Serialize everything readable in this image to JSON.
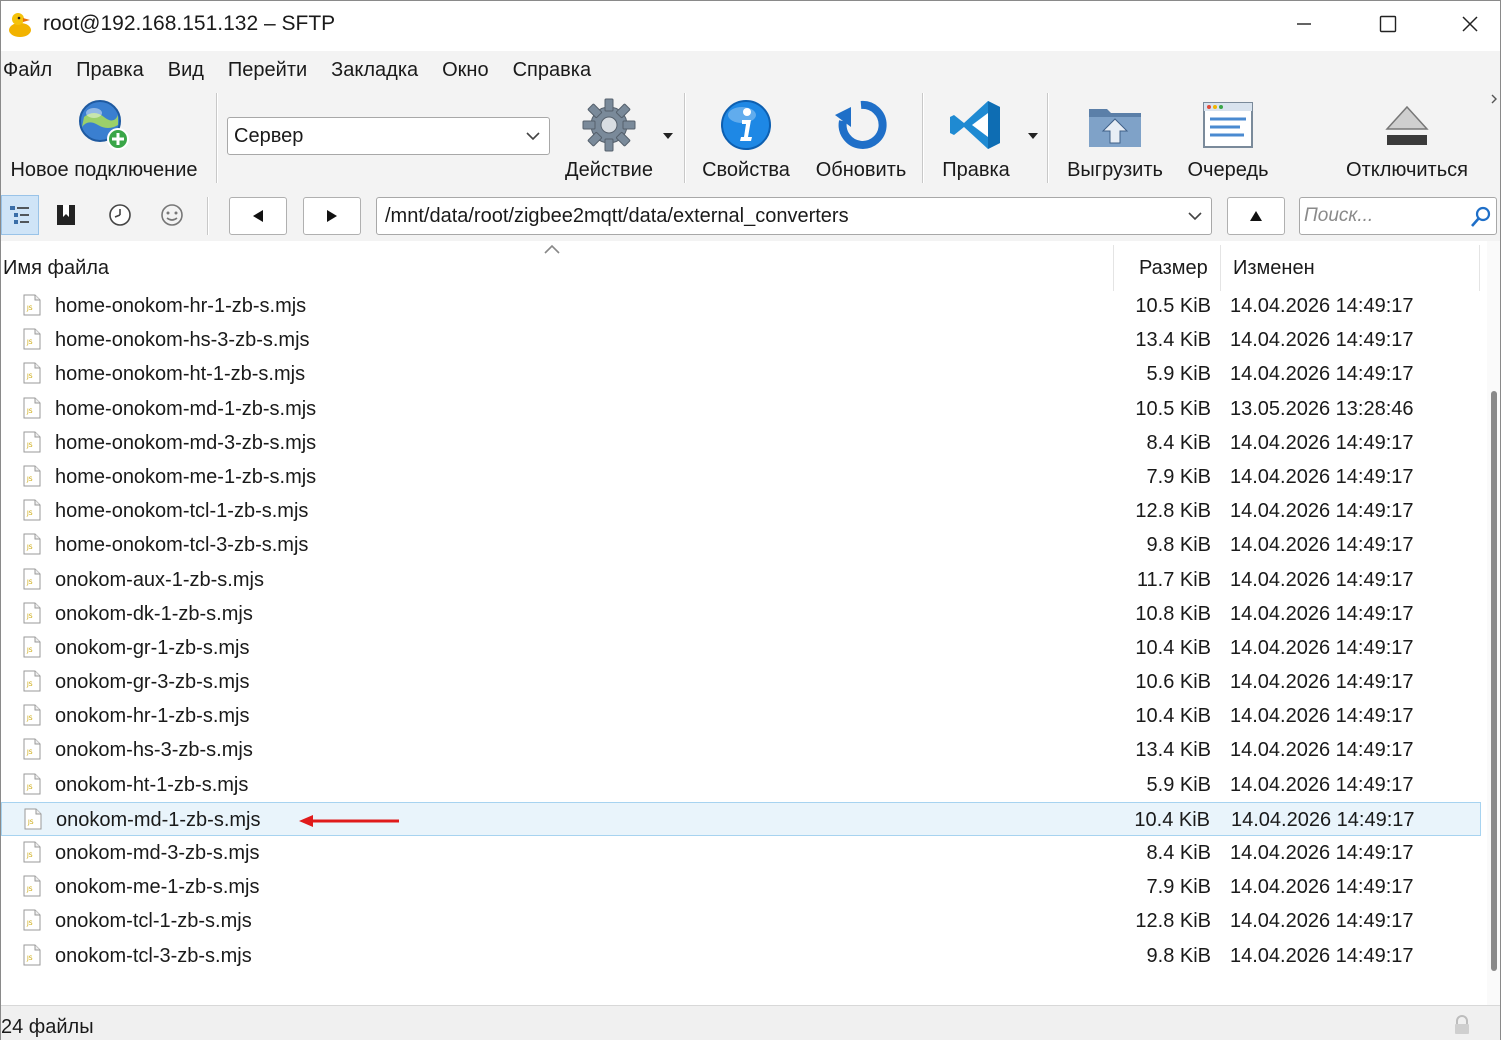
{
  "window": {
    "title": "root@192.168.151.132 – SFTP"
  },
  "menu": [
    "Файл",
    "Правка",
    "Вид",
    "Перейти",
    "Закладка",
    "Окно",
    "Справка"
  ],
  "toolbar": {
    "new_connection": "Новое подключение",
    "server_value": "Сервер",
    "action": "Действие",
    "properties": "Свойства",
    "refresh": "Обновить",
    "edit": "Правка",
    "upload": "Выгрузить",
    "queue": "Очередь",
    "disconnect": "Отключиться"
  },
  "addressbar": {
    "path": "/mnt/data/root/zigbee2mqtt/data/external_converters",
    "search_placeholder": "Поиск..."
  },
  "columns": {
    "name": "Имя файла",
    "size": "Размер",
    "modified": "Изменен"
  },
  "files": [
    {
      "name": "home-onokom-hr-1-zb-s.mjs",
      "size": "10.5 KiB",
      "modified": "14.04.2026 14:49:17"
    },
    {
      "name": "home-onokom-hs-3-zb-s.mjs",
      "size": "13.4 KiB",
      "modified": "14.04.2026 14:49:17"
    },
    {
      "name": "home-onokom-ht-1-zb-s.mjs",
      "size": "5.9 KiB",
      "modified": "14.04.2026 14:49:17"
    },
    {
      "name": "home-onokom-md-1-zb-s.mjs",
      "size": "10.5 KiB",
      "modified": "13.05.2026 13:28:46"
    },
    {
      "name": "home-onokom-md-3-zb-s.mjs",
      "size": "8.4 KiB",
      "modified": "14.04.2026 14:49:17"
    },
    {
      "name": "home-onokom-me-1-zb-s.mjs",
      "size": "7.9 KiB",
      "modified": "14.04.2026 14:49:17"
    },
    {
      "name": "home-onokom-tcl-1-zb-s.mjs",
      "size": "12.8 KiB",
      "modified": "14.04.2026 14:49:17"
    },
    {
      "name": "home-onokom-tcl-3-zb-s.mjs",
      "size": "9.8 KiB",
      "modified": "14.04.2026 14:49:17"
    },
    {
      "name": "onokom-aux-1-zb-s.mjs",
      "size": "11.7 KiB",
      "modified": "14.04.2026 14:49:17"
    },
    {
      "name": "onokom-dk-1-zb-s.mjs",
      "size": "10.8 KiB",
      "modified": "14.04.2026 14:49:17"
    },
    {
      "name": "onokom-gr-1-zb-s.mjs",
      "size": "10.4 KiB",
      "modified": "14.04.2026 14:49:17"
    },
    {
      "name": "onokom-gr-3-zb-s.mjs",
      "size": "10.6 KiB",
      "modified": "14.04.2026 14:49:17"
    },
    {
      "name": "onokom-hr-1-zb-s.mjs",
      "size": "10.4 KiB",
      "modified": "14.04.2026 14:49:17"
    },
    {
      "name": "onokom-hs-3-zb-s.mjs",
      "size": "13.4 KiB",
      "modified": "14.04.2026 14:49:17"
    },
    {
      "name": "onokom-ht-1-zb-s.mjs",
      "size": "5.9 KiB",
      "modified": "14.04.2026 14:49:17"
    },
    {
      "name": "onokom-md-1-zb-s.mjs",
      "size": "10.4 KiB",
      "modified": "14.04.2026 14:49:17",
      "selected": true
    },
    {
      "name": "onokom-md-3-zb-s.mjs",
      "size": "8.4 KiB",
      "modified": "14.04.2026 14:49:17"
    },
    {
      "name": "onokom-me-1-zb-s.mjs",
      "size": "7.9 KiB",
      "modified": "14.04.2026 14:49:17"
    },
    {
      "name": "onokom-tcl-1-zb-s.mjs",
      "size": "12.8 KiB",
      "modified": "14.04.2026 14:49:17"
    },
    {
      "name": "onokom-tcl-3-zb-s.mjs",
      "size": "9.8 KiB",
      "modified": "14.04.2026 14:49:17"
    }
  ],
  "status": {
    "text": "24 файлы"
  },
  "colors": {
    "selection_bg": "#e9f4fb",
    "selection_border": "#a7d3f0",
    "annotation_arrow": "#e01b1b",
    "toolbar_bg": "#f3f3f3"
  },
  "icons": {
    "file": "js-file-icon",
    "annotation": "red-arrow-icon"
  }
}
